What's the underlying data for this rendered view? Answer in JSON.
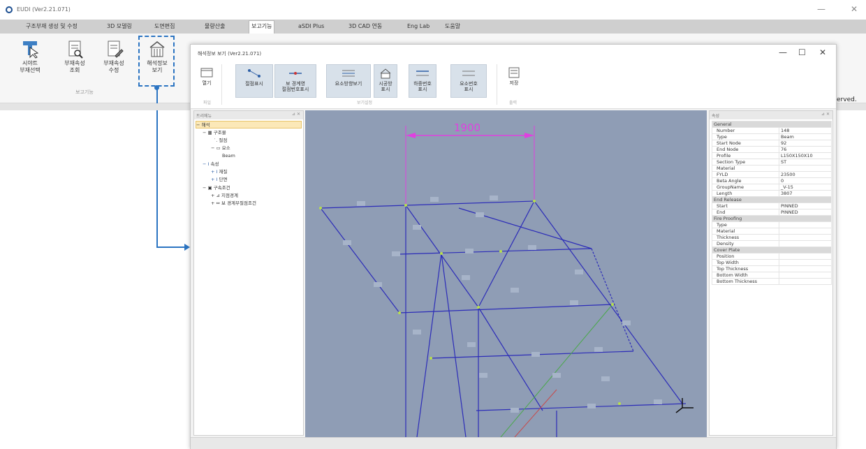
{
  "app": {
    "title": "EUDI (Ver2.21.071)",
    "menu": [
      "구조부재 생성 및 수정",
      "3D 모델링",
      "도면편집",
      "물량산출",
      "보고기능",
      "aSDI Plus",
      "3D CAD 연동",
      "Eng Lab",
      "도움말"
    ],
    "active_menu": "보고기능",
    "ribbon_buttons": [
      {
        "label": "시야트\n부재선택",
        "icon": "cursor-select-icon"
      },
      {
        "label": "부재속성\n조회",
        "icon": "document-search-icon"
      },
      {
        "label": "부재속성\n수정",
        "icon": "document-edit-icon"
      },
      {
        "label": "해석정보\n보기",
        "icon": "analysis-info-icon"
      }
    ],
    "ribbon_group": "보고기능",
    "status_text": "erved."
  },
  "dialog": {
    "title": "해석정보 보기 (Ver2.21.071)",
    "toolbar": [
      {
        "label": "열기",
        "icon": "open-file-icon"
      },
      {
        "label": "절점표시",
        "icon": "node-display-icon"
      },
      {
        "label": "보 경계영\n절점번호표시",
        "icon": "beam-node-number-icon"
      },
      {
        "label": "요소방향보기",
        "icon": "element-direction-icon"
      },
      {
        "label": "시공방\n표시",
        "icon": "construction-display-icon"
      },
      {
        "label": "하중번호\n표시",
        "icon": "load-number-icon"
      },
      {
        "label": "요소번호\n표시",
        "icon": "element-number-icon"
      },
      {
        "label": "저장",
        "icon": "save-icon"
      }
    ],
    "groups": [
      "파일",
      "보기설정",
      "출력"
    ],
    "tree": {
      "header": "트리메뉴",
      "items": [
        "해석",
        "구조물",
        "절점",
        "요소",
        "Beam",
        "속성",
        "재질",
        "단면",
        "구속조건",
        "지점경계",
        "보 경계부절점조건"
      ]
    },
    "dimension_label": "1900",
    "properties": {
      "header": "속성",
      "categories": [
        {
          "name": "General",
          "rows": [
            [
              "Number",
              "148"
            ],
            [
              "Type",
              "Beam"
            ],
            [
              "Start Node",
              "92"
            ],
            [
              "End Node",
              "76"
            ],
            [
              "Profile",
              "L150X150X10"
            ],
            [
              "Section Type",
              "ST"
            ],
            [
              "Material",
              ""
            ],
            [
              "FYLD",
              "23500"
            ],
            [
              "Beta Angle",
              "0"
            ],
            [
              "GroupName",
              "_V-15"
            ],
            [
              "Length",
              "3807"
            ]
          ]
        },
        {
          "name": "End Release",
          "rows": [
            [
              "Start",
              "PINNED"
            ],
            [
              "End",
              "PINNED"
            ]
          ]
        },
        {
          "name": "Fire Proofing",
          "rows": [
            [
              "Type",
              ""
            ],
            [
              "Material",
              ""
            ],
            [
              "Thickness",
              ""
            ],
            [
              "Density",
              ""
            ]
          ]
        },
        {
          "name": "Cover Plate",
          "rows": [
            [
              "Position",
              ""
            ],
            [
              "Top Width",
              ""
            ],
            [
              "Top Thickness",
              ""
            ],
            [
              "Bottom Width",
              ""
            ],
            [
              "Bottom Thickness",
              ""
            ]
          ]
        }
      ]
    }
  }
}
